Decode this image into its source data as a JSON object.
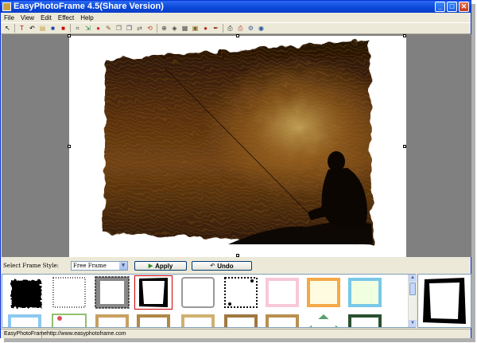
{
  "window": {
    "title": "EasyPhotoFrame 4.5(Share Version)"
  },
  "menu": [
    "File",
    "View",
    "Edit",
    "Effect",
    "Help"
  ],
  "toolbar": {
    "icons": [
      {
        "name": "pointer-icon",
        "glyph": "↖",
        "color": "#000000"
      },
      {
        "name": "text-tool-icon",
        "glyph": "T",
        "color": "#cc0000"
      },
      {
        "name": "rotate-icon",
        "glyph": "↶",
        "color": "#000000"
      },
      {
        "name": "open-icon",
        "glyph": "▤",
        "color": "#c8a040"
      },
      {
        "name": "save-icon",
        "glyph": "■",
        "color": "#2040a0"
      },
      {
        "name": "save-as-icon",
        "glyph": "■",
        "color": "#cc0000"
      },
      {
        "name": "crop-icon",
        "glyph": "⌗",
        "color": "#606060"
      },
      {
        "name": "export-icon",
        "glyph": "⇲",
        "color": "#208040"
      },
      {
        "name": "effect-icon",
        "glyph": "●",
        "color": "#cc3030"
      },
      {
        "name": "brush-icon",
        "glyph": "✎",
        "color": "#806020"
      },
      {
        "name": "copy-icon",
        "glyph": "❐",
        "color": "#606060"
      },
      {
        "name": "paste-icon",
        "glyph": "❐",
        "color": "#404080"
      },
      {
        "name": "flip-icon",
        "glyph": "⇄",
        "color": "#606060"
      },
      {
        "name": "undo-icon",
        "glyph": "⟲",
        "color": "#c04020"
      },
      {
        "name": "zoom-in-icon",
        "glyph": "⊕",
        "color": "#404040"
      },
      {
        "name": "layers-icon",
        "glyph": "◈",
        "color": "#404040"
      },
      {
        "name": "grid-icon",
        "glyph": "▦",
        "color": "#505050"
      },
      {
        "name": "frame-icon",
        "glyph": "▣",
        "color": "#806020"
      },
      {
        "name": "color-icon",
        "glyph": "●",
        "color": "#c02020"
      },
      {
        "name": "pen-icon",
        "glyph": "✒",
        "color": "#a02020"
      },
      {
        "name": "print-icon",
        "glyph": "⎙",
        "color": "#404040"
      },
      {
        "name": "print-preview-icon",
        "glyph": "⎙",
        "color": "#c04040"
      },
      {
        "name": "settings-icon",
        "glyph": "⚙",
        "color": "#4060a0"
      },
      {
        "name": "help-icon",
        "glyph": "◉",
        "color": "#2050a0"
      }
    ]
  },
  "frame_style": {
    "label": "Select Frame Style:",
    "selected": "Free Frame",
    "apply_label": "Apply",
    "undo_label": "Undo"
  },
  "status": {
    "app": "EasyPhotoFrame",
    "url": "http://www.easyphotoframe.com"
  }
}
